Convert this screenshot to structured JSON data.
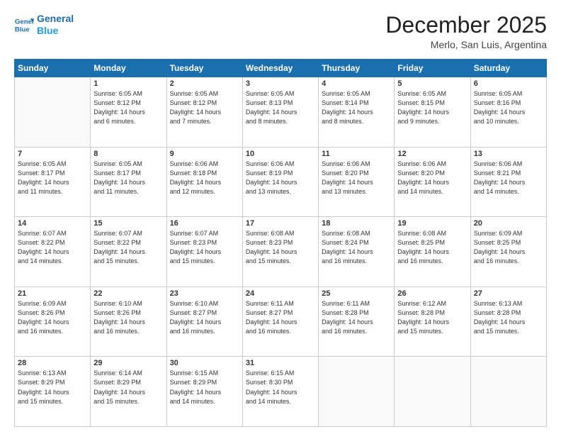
{
  "header": {
    "logo_line1": "General",
    "logo_line2": "Blue",
    "title": "December 2025",
    "subtitle": "Merlo, San Luis, Argentina"
  },
  "weekdays": [
    "Sunday",
    "Monday",
    "Tuesday",
    "Wednesday",
    "Thursday",
    "Friday",
    "Saturday"
  ],
  "weeks": [
    [
      {
        "day": "",
        "info": ""
      },
      {
        "day": "1",
        "info": "Sunrise: 6:05 AM\nSunset: 8:12 PM\nDaylight: 14 hours\nand 6 minutes."
      },
      {
        "day": "2",
        "info": "Sunrise: 6:05 AM\nSunset: 8:12 PM\nDaylight: 14 hours\nand 7 minutes."
      },
      {
        "day": "3",
        "info": "Sunrise: 6:05 AM\nSunset: 8:13 PM\nDaylight: 14 hours\nand 8 minutes."
      },
      {
        "day": "4",
        "info": "Sunrise: 6:05 AM\nSunset: 8:14 PM\nDaylight: 14 hours\nand 8 minutes."
      },
      {
        "day": "5",
        "info": "Sunrise: 6:05 AM\nSunset: 8:15 PM\nDaylight: 14 hours\nand 9 minutes."
      },
      {
        "day": "6",
        "info": "Sunrise: 6:05 AM\nSunset: 8:16 PM\nDaylight: 14 hours\nand 10 minutes."
      }
    ],
    [
      {
        "day": "7",
        "info": "Sunrise: 6:05 AM\nSunset: 8:17 PM\nDaylight: 14 hours\nand 11 minutes."
      },
      {
        "day": "8",
        "info": "Sunrise: 6:05 AM\nSunset: 8:17 PM\nDaylight: 14 hours\nand 11 minutes."
      },
      {
        "day": "9",
        "info": "Sunrise: 6:06 AM\nSunset: 8:18 PM\nDaylight: 14 hours\nand 12 minutes."
      },
      {
        "day": "10",
        "info": "Sunrise: 6:06 AM\nSunset: 8:19 PM\nDaylight: 14 hours\nand 13 minutes."
      },
      {
        "day": "11",
        "info": "Sunrise: 6:06 AM\nSunset: 8:20 PM\nDaylight: 14 hours\nand 13 minutes."
      },
      {
        "day": "12",
        "info": "Sunrise: 6:06 AM\nSunset: 8:20 PM\nDaylight: 14 hours\nand 14 minutes."
      },
      {
        "day": "13",
        "info": "Sunrise: 6:06 AM\nSunset: 8:21 PM\nDaylight: 14 hours\nand 14 minutes."
      }
    ],
    [
      {
        "day": "14",
        "info": "Sunrise: 6:07 AM\nSunset: 8:22 PM\nDaylight: 14 hours\nand 14 minutes."
      },
      {
        "day": "15",
        "info": "Sunrise: 6:07 AM\nSunset: 8:22 PM\nDaylight: 14 hours\nand 15 minutes."
      },
      {
        "day": "16",
        "info": "Sunrise: 6:07 AM\nSunset: 8:23 PM\nDaylight: 14 hours\nand 15 minutes."
      },
      {
        "day": "17",
        "info": "Sunrise: 6:08 AM\nSunset: 8:23 PM\nDaylight: 14 hours\nand 15 minutes."
      },
      {
        "day": "18",
        "info": "Sunrise: 6:08 AM\nSunset: 8:24 PM\nDaylight: 14 hours\nand 16 minutes."
      },
      {
        "day": "19",
        "info": "Sunrise: 6:08 AM\nSunset: 8:25 PM\nDaylight: 14 hours\nand 16 minutes."
      },
      {
        "day": "20",
        "info": "Sunrise: 6:09 AM\nSunset: 8:25 PM\nDaylight: 14 hours\nand 16 minutes."
      }
    ],
    [
      {
        "day": "21",
        "info": "Sunrise: 6:09 AM\nSunset: 8:26 PM\nDaylight: 14 hours\nand 16 minutes."
      },
      {
        "day": "22",
        "info": "Sunrise: 6:10 AM\nSunset: 8:26 PM\nDaylight: 14 hours\nand 16 minutes."
      },
      {
        "day": "23",
        "info": "Sunrise: 6:10 AM\nSunset: 8:27 PM\nDaylight: 14 hours\nand 16 minutes."
      },
      {
        "day": "24",
        "info": "Sunrise: 6:11 AM\nSunset: 8:27 PM\nDaylight: 14 hours\nand 16 minutes."
      },
      {
        "day": "25",
        "info": "Sunrise: 6:11 AM\nSunset: 8:28 PM\nDaylight: 14 hours\nand 16 minutes."
      },
      {
        "day": "26",
        "info": "Sunrise: 6:12 AM\nSunset: 8:28 PM\nDaylight: 14 hours\nand 15 minutes."
      },
      {
        "day": "27",
        "info": "Sunrise: 6:13 AM\nSunset: 8:28 PM\nDaylight: 14 hours\nand 15 minutes."
      }
    ],
    [
      {
        "day": "28",
        "info": "Sunrise: 6:13 AM\nSunset: 8:29 PM\nDaylight: 14 hours\nand 15 minutes."
      },
      {
        "day": "29",
        "info": "Sunrise: 6:14 AM\nSunset: 8:29 PM\nDaylight: 14 hours\nand 15 minutes."
      },
      {
        "day": "30",
        "info": "Sunrise: 6:15 AM\nSunset: 8:29 PM\nDaylight: 14 hours\nand 14 minutes."
      },
      {
        "day": "31",
        "info": "Sunrise: 6:15 AM\nSunset: 8:30 PM\nDaylight: 14 hours\nand 14 minutes."
      },
      {
        "day": "",
        "info": ""
      },
      {
        "day": "",
        "info": ""
      },
      {
        "day": "",
        "info": ""
      }
    ]
  ]
}
